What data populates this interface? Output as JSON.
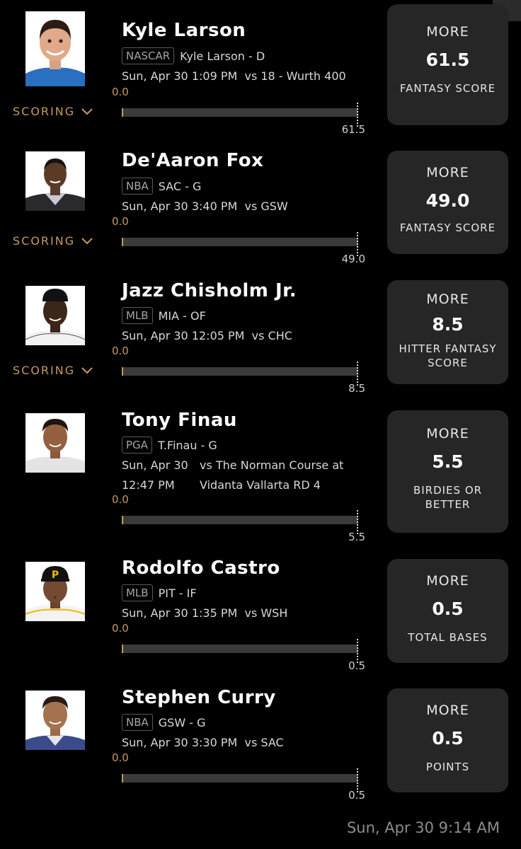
{
  "cards": [
    {
      "name": "Kyle Larson",
      "league": "NASCAR",
      "team": "Kyle Larson - D",
      "date": "Sun, Apr 30 1:09 PM",
      "opponent": "vs 18 - Wurth 400",
      "start": "0.0",
      "scoring_label": "SCORING",
      "target": "61.5",
      "pick": {
        "direction": "MORE",
        "line": "61.5",
        "stat": "FANTASY SCORE"
      }
    },
    {
      "name": "De'Aaron Fox",
      "league": "NBA",
      "team": "SAC - G",
      "date": "Sun, Apr 30 3:40 PM",
      "opponent": "vs GSW",
      "start": "0.0",
      "scoring_label": "SCORING",
      "target": "49.0",
      "pick": {
        "direction": "MORE",
        "line": "49.0",
        "stat": "FANTASY SCORE"
      }
    },
    {
      "name": "Jazz Chisholm Jr.",
      "league": "MLB",
      "team": "MIA - OF",
      "date": "Sun, Apr 30 12:05 PM",
      "opponent": "vs CHC",
      "start": "0.0",
      "scoring_label": "SCORING",
      "target": "8.5",
      "pick": {
        "direction": "MORE",
        "line": "8.5",
        "stat_line1": "HITTER FANTASY",
        "stat_line2": "SCORE"
      }
    },
    {
      "name": "Tony Finau",
      "league": "PGA",
      "team": "T.Finau - G",
      "date_line1": "Sun, Apr 30",
      "date_line2": "12:47 PM",
      "opponent_line1": "vs The Norman Course at",
      "opponent_line2": "Vidanta Vallarta RD 4",
      "start": "0.0",
      "target": "5.5",
      "pick": {
        "direction": "MORE",
        "line": "5.5",
        "stat_line1": "BIRDIES OR",
        "stat_line2": "BETTER"
      }
    },
    {
      "name": "Rodolfo Castro",
      "league": "MLB",
      "team": "PIT - IF",
      "date": "Sun, Apr 30 1:35 PM",
      "opponent": "vs WSH",
      "start": "0.0",
      "target": "0.5",
      "pick": {
        "direction": "MORE",
        "line": "0.5",
        "stat": "TOTAL BASES"
      }
    },
    {
      "name": "Stephen Curry",
      "league": "NBA",
      "team": "GSW - G",
      "date": "Sun, Apr 30 3:30 PM",
      "opponent": "vs SAC",
      "start": "0.0",
      "target": "0.5",
      "pick": {
        "direction": "MORE",
        "line": "0.5",
        "stat": "POINTS"
      }
    }
  ],
  "timestamp": "Sun, Apr 30 9:14 AM",
  "icons": {
    "avatar": "player-headshot-icon",
    "chevron": "chevron-down-icon"
  },
  "colors": {
    "accent": "#c59a5b",
    "card_bg": "#262626",
    "bar_bg": "#3a3a3a",
    "background": "#000000"
  }
}
